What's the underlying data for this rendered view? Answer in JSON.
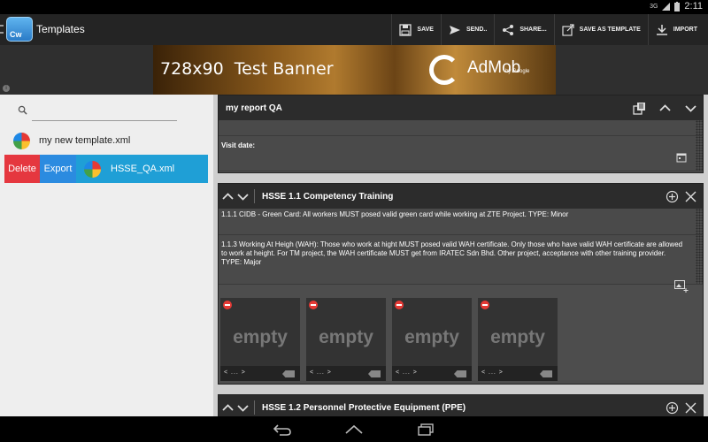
{
  "status": {
    "network": "3G",
    "time": "2:11"
  },
  "actionbar": {
    "app_icon_text": "Cw",
    "title": "Templates",
    "actions": [
      {
        "label": "SAVE",
        "icon": "floppy-icon"
      },
      {
        "label": "SEND..",
        "icon": "send-icon"
      },
      {
        "label": "SHARE...",
        "icon": "share-icon"
      },
      {
        "label": "SAVE AS TEMPLATE",
        "icon": "export-icon"
      },
      {
        "label": "IMPORT",
        "icon": "download-icon"
      }
    ]
  },
  "banner": {
    "size_text": "728x90",
    "text": "Test Banner",
    "brand": "AdMob",
    "brand_sub": "by Google"
  },
  "sidebar": {
    "search": {
      "value": "",
      "placeholder": ""
    },
    "files": [
      {
        "name": "my new template.xml"
      },
      {
        "name": "HSSE_QA.xml"
      }
    ],
    "delete_label": "Delete",
    "export_label": "Export"
  },
  "report": {
    "title": "my report QA",
    "visit_date_label": "Visit date:"
  },
  "sections": [
    {
      "title": "HSSE 1.1 Competency Training",
      "items": [
        "1.1.1 CIDB - Green Card: All workers MUST posed valid green card while working at ZTE Project. TYPE: Minor",
        "1.1.3 Working At Heigh (WAH): Those who work at hight MUST posed valid WAH certificate. Only those who have valid WAH certificate are allowed to work at height. For TM project, the WAH certificate MUST get from IRATEC Sdn Bhd. Other project, acceptance with other training provider. TYPE: Major"
      ],
      "photos": [
        {
          "label": "empty",
          "nav": "< ... >"
        },
        {
          "label": "empty",
          "nav": "< ... >"
        },
        {
          "label": "empty",
          "nav": "< ... >"
        },
        {
          "label": "empty",
          "nav": "< ... >"
        }
      ]
    },
    {
      "title": "HSSE 1.2 Personnel Protective Equipment (PPE)"
    }
  ]
}
